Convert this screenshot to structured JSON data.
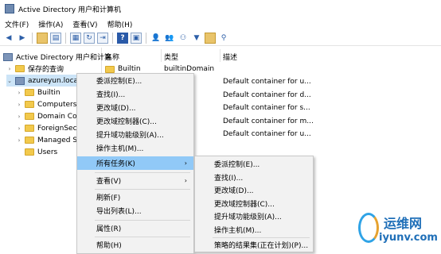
{
  "window": {
    "title": "Active Directory 用户和计算机"
  },
  "menubar": [
    "文件(F)",
    "操作(A)",
    "查看(V)",
    "帮助(H)"
  ],
  "toolbar_icons": [
    "back-arrow-icon",
    "forward-arrow-icon",
    "up-folder-icon",
    "console-tree-icon",
    "properties-icon",
    "refresh-icon",
    "export-icon",
    "help-icon",
    "mmc-icon",
    "users-icon",
    "add-user-icon",
    "add-group-icon",
    "filter-icon",
    "domain-icon",
    "find-icon"
  ],
  "tree": {
    "root": "Active Directory 用户和计算",
    "saved_queries": "保存的查询",
    "domain": "azureyun.local",
    "children": [
      "Builtin",
      "Computers",
      "Domain Co",
      "ForeignSec",
      "Managed S",
      "Users"
    ]
  },
  "list": {
    "headers": {
      "name": "名称",
      "type": "类型",
      "desc": "描述"
    },
    "rows": [
      {
        "name": "Builtin",
        "type": "builtinDomain",
        "desc": ""
      },
      {
        "name": "",
        "type": "",
        "desc": "Default container for u..."
      },
      {
        "name": "",
        "type": "",
        "desc": "Default container for d..."
      },
      {
        "name": "",
        "type": "",
        "desc": "Default container for s..."
      },
      {
        "name": "",
        "type": "",
        "desc": "Default container for m..."
      },
      {
        "name": "",
        "type": "",
        "desc": "Default container for u..."
      }
    ]
  },
  "context_menu": {
    "items": [
      "委派控制(E)...",
      "查找(I)...",
      "更改域(D)...",
      "更改域控制器(C)...",
      "提升域功能级别(A)...",
      "操作主机(M)..."
    ],
    "all_tasks": "所有任务(K)",
    "view": "查看(V)",
    "refresh": "刷新(F)",
    "export": "导出列表(L)...",
    "properties": "属性(R)",
    "help": "帮助(H)"
  },
  "submenu": {
    "items": [
      "委派控制(E)...",
      "查找(I)...",
      "更改域(D)...",
      "更改域控制器(C)...",
      "提升域功能级别(A)...",
      "操作主机(M)..."
    ],
    "rsop": "策略的结果集(正在计划)(P)..."
  },
  "watermark": {
    "cn": "运维网",
    "url": "iyunv.com"
  },
  "colors": {
    "highlight": "#91c9f7",
    "menu_bg": "#f2f2f2",
    "folder": "#f2c94c"
  }
}
